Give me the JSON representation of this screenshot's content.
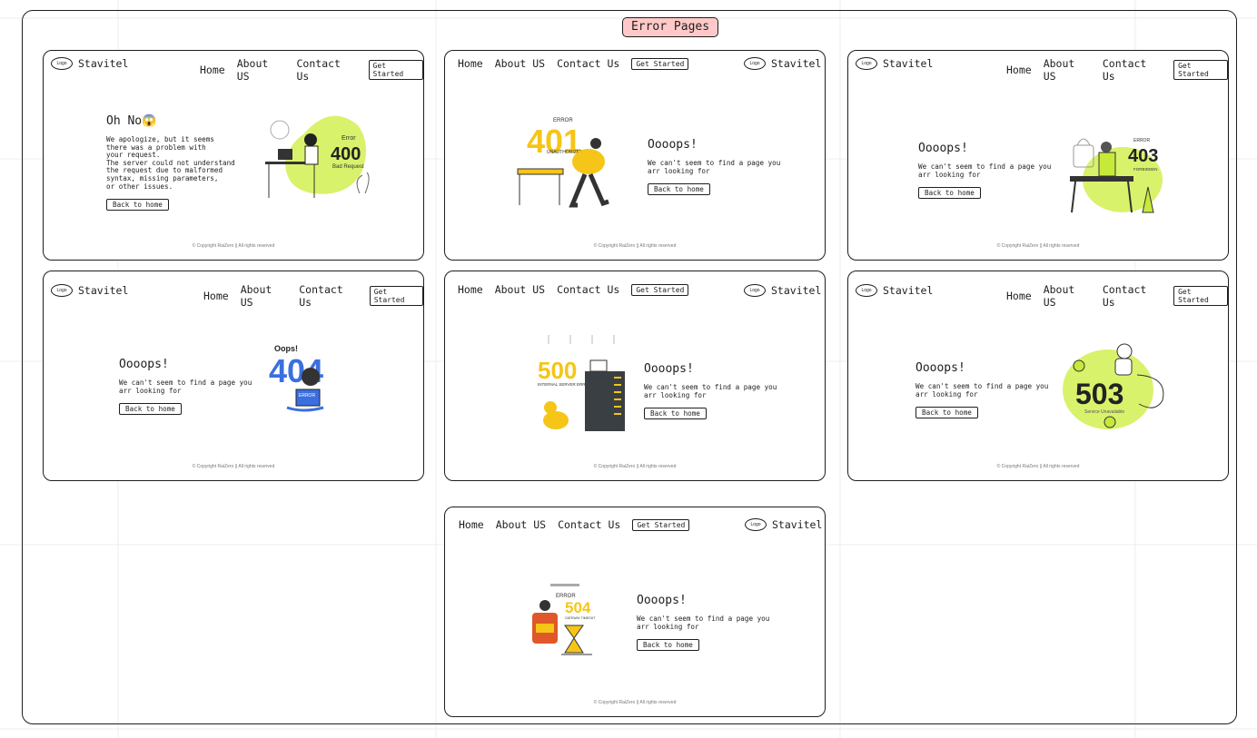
{
  "title": "Error Pages",
  "nav": {
    "home": "Home",
    "about": "About US",
    "contact": "Contact Us",
    "cta": "Get Started",
    "logo": "Logo",
    "brand": "Stavitel"
  },
  "footer": "© Copyright RaiZero || All rights reserved",
  "back_label": "Back to home",
  "pages": [
    {
      "code": "400",
      "heading": "Oh No😱",
      "message": "We apologize, but it seems\nthere was a problem with\nyour request.\nThe server could not understand\nthe request due to malformed\nsyntax, missing parameters,\nor other issues.",
      "art_top": "Error",
      "art_code": "400",
      "art_sub": "Bad Request"
    },
    {
      "code": "401",
      "heading": "Oooops!",
      "message": "We can't seem to find a page you\narr looking for",
      "art_top": "ERROR",
      "art_code": "401",
      "art_sub": "UNAUTHORIZED"
    },
    {
      "code": "403",
      "heading": "Oooops!",
      "message": "We can't seem to find a page you\narr looking for",
      "art_top": "ERROR",
      "art_code": "403",
      "art_sub": "FORBIDDEN"
    },
    {
      "code": "404",
      "heading": "Oooops!",
      "message": "We can't seem to find a page you\narr looking for",
      "art_top": "Oops!",
      "art_code": "404",
      "art_sub": "ERROR"
    },
    {
      "code": "500",
      "heading": "Oooops!",
      "message": "We can't seem to find a page you\narr looking for",
      "art_top": "",
      "art_code": "500",
      "art_sub": "INTERNAL SERVER ERROR"
    },
    {
      "code": "503",
      "heading": "Oooops!",
      "message": "We can't seem to find a page you\narr looking for",
      "art_top": "",
      "art_code": "503",
      "art_sub": "Service Unavailable"
    },
    {
      "code": "504",
      "heading": "Oooops!",
      "message": "We can't seem to find a page you\narr looking for",
      "art_top": "ERROR",
      "art_code": "504",
      "art_sub": "GATEWAY TIMEOUT"
    }
  ],
  "colors": {
    "accent_lime": "#d9f26b",
    "accent_yellow": "#f5c518",
    "accent_blue": "#3b6fe0",
    "title_bg": "#ffc9c9"
  }
}
